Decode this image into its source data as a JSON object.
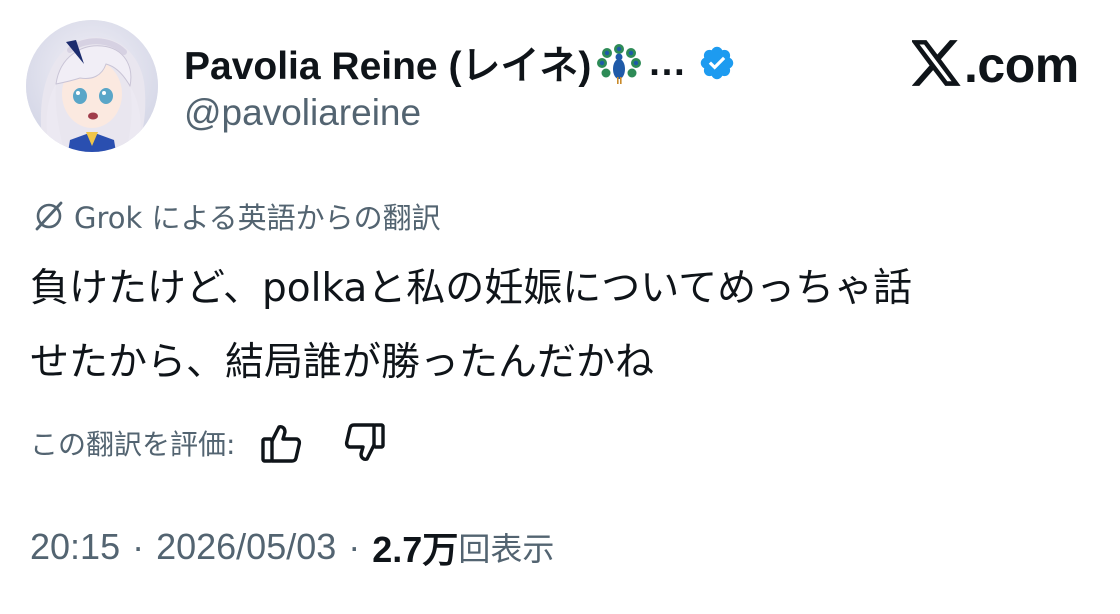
{
  "author": {
    "display_name": "Pavolia Reine (レイネ)",
    "name_emoji": "peacock-icon",
    "name_truncation": "…",
    "verified_badge": "verified-badge-icon",
    "handle": "@pavoliareine"
  },
  "brand": {
    "logo": "x-logo-icon",
    "text": ".com"
  },
  "translation": {
    "icon": "grok-icon",
    "attribution": "Grok による英語からの翻訳"
  },
  "tweet": {
    "lines": [
      "負けたけど、polkaと私の妊娠についてめっちゃ話",
      "せたから、結局誰が勝ったんだかね"
    ]
  },
  "rating": {
    "label": "この翻訳を評価:",
    "thumbs_up": "thumbs-up-icon",
    "thumbs_down": "thumbs-down-icon"
  },
  "meta": {
    "time": "20:15",
    "separator": "·",
    "date": "2026/05/03",
    "views_count": "2.7万",
    "views_label": "回表示"
  },
  "colors": {
    "text_primary": "#0f1419",
    "text_secondary": "#536471",
    "verified_blue": "#1d9bf0"
  }
}
